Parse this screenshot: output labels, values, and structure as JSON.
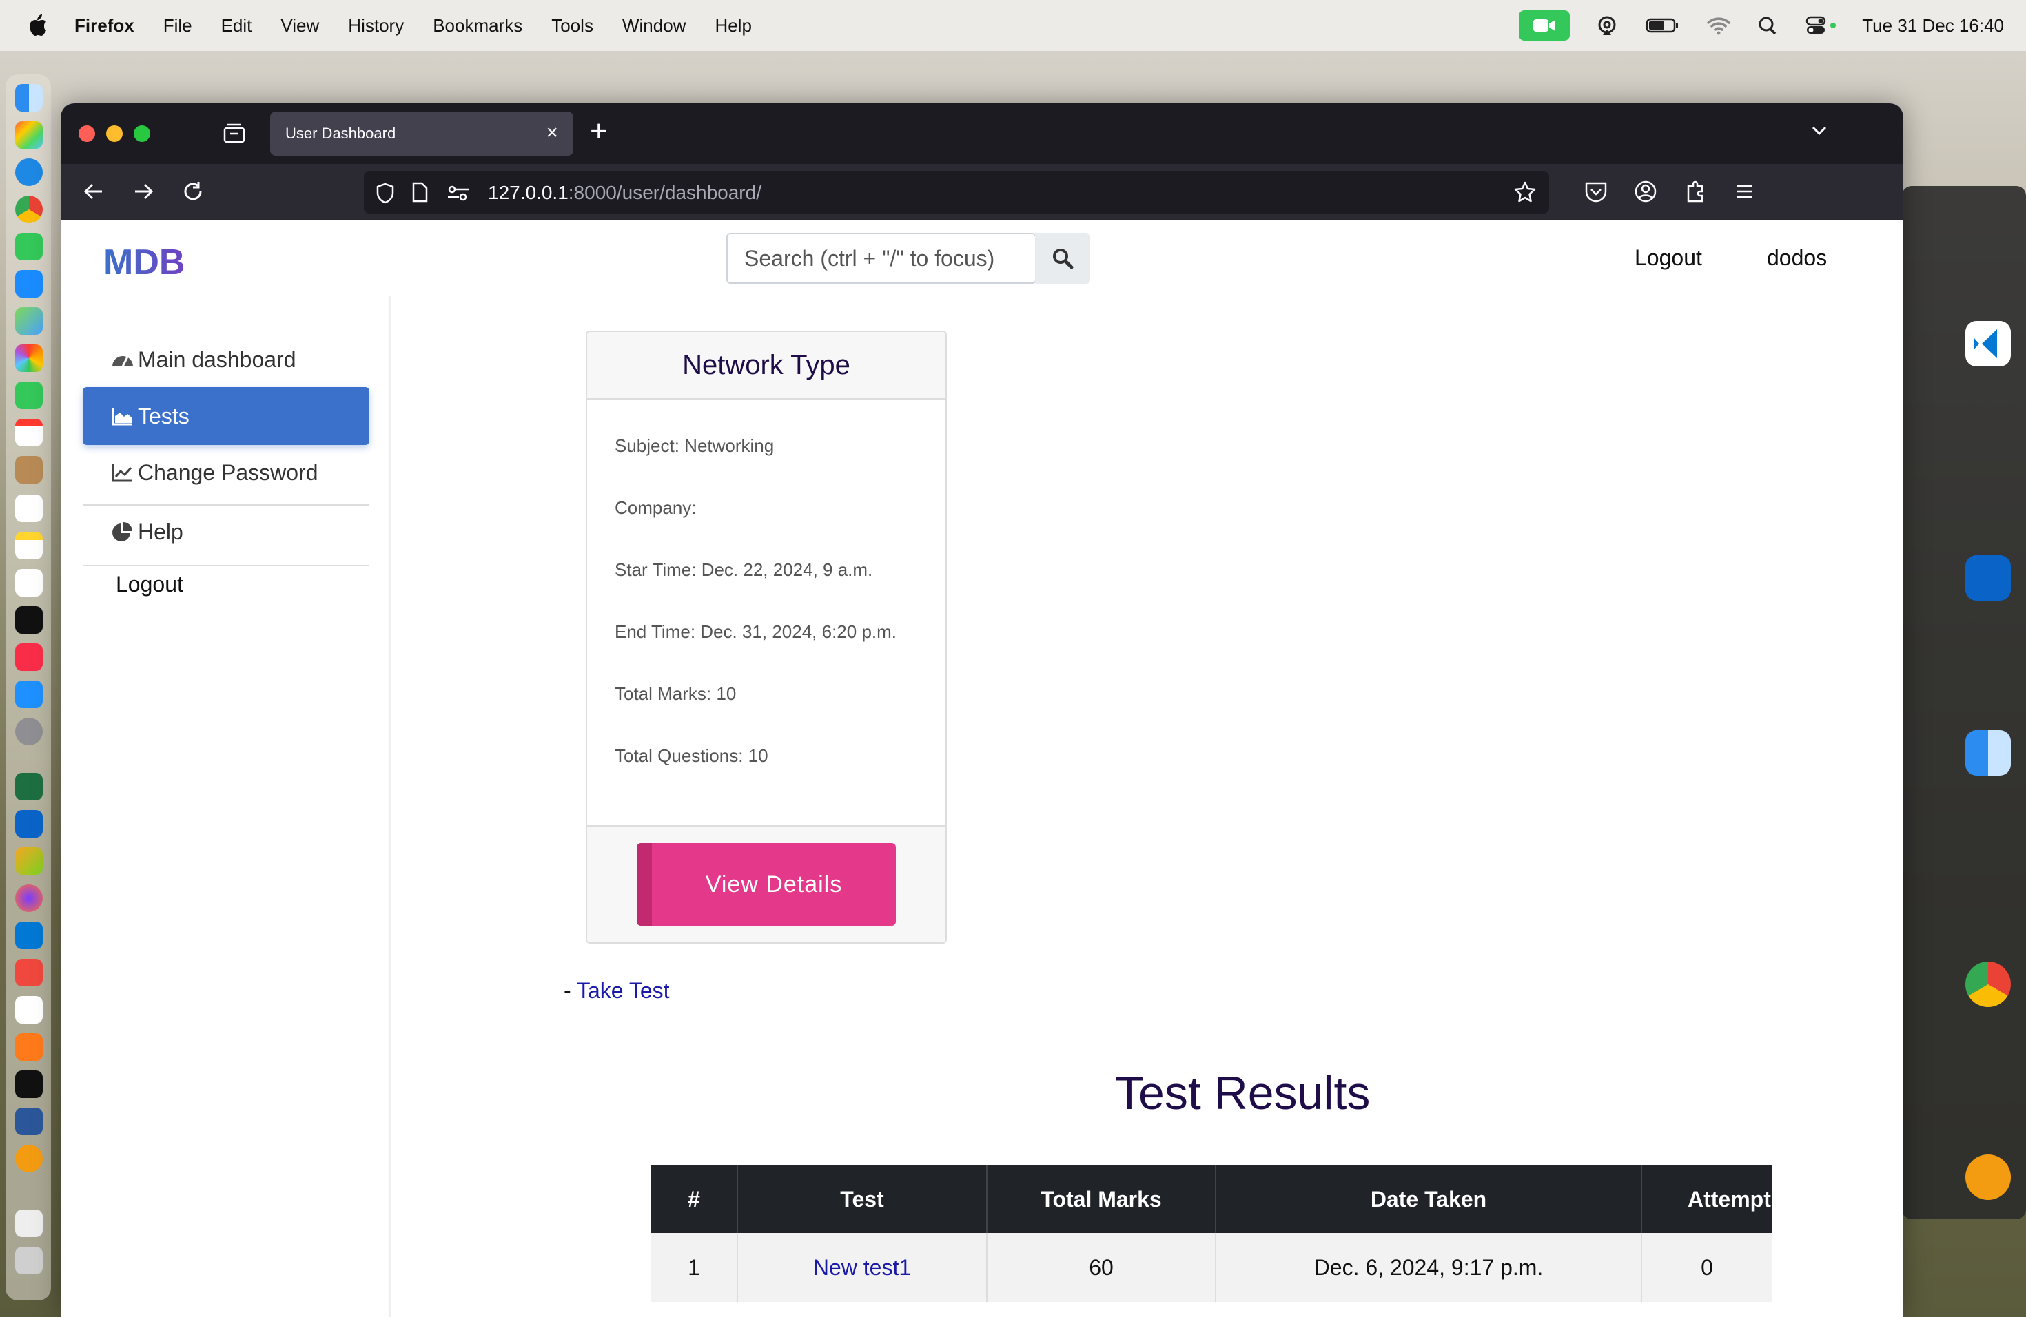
{
  "menubar": {
    "app": "Firefox",
    "items": [
      "File",
      "Edit",
      "View",
      "History",
      "Bookmarks",
      "Tools",
      "Window",
      "Help"
    ],
    "clock": "Tue 31 Dec  16:40"
  },
  "browser": {
    "tab_title": "User Dashboard",
    "url_host": "127.0.0.1",
    "url_path": ":8000/user/dashboard/"
  },
  "header": {
    "logo": "MDB",
    "search_placeholder": "Search (ctrl + \"/\" to focus)",
    "logout": "Logout",
    "username": "dodos"
  },
  "sidebar": {
    "items": [
      {
        "label": "Main dashboard",
        "icon": "dashboard-gauge-icon"
      },
      {
        "label": "Tests",
        "icon": "area-chart-icon",
        "active": true
      },
      {
        "label": "Change Password",
        "icon": "line-chart-icon"
      },
      {
        "label": "Help",
        "icon": "pie-chart-icon"
      }
    ],
    "logout": "Logout"
  },
  "test_card": {
    "title": "Network Type",
    "subject": "Subject: Networking",
    "company": "Company:",
    "start": "Star Time: Dec. 22, 2024, 9 a.m.",
    "end": "End Time: Dec. 31, 2024, 6:20 p.m.",
    "marks": "Total Marks: 10",
    "questions": "Total Questions: 10",
    "button": "View Details"
  },
  "take_test": {
    "prefix": "- ",
    "link": "Take Test"
  },
  "results": {
    "title": "Test Results",
    "columns": [
      "#",
      "Test",
      "Total Marks",
      "Date Taken",
      "Attempt"
    ],
    "rows": [
      {
        "num": "1",
        "test": "New test1",
        "marks": "60",
        "date": "Dec. 6, 2024, 9:17 p.m.",
        "attempt": "0"
      }
    ]
  },
  "colors": {
    "accent": "#3b71ca",
    "button": "#e4398a",
    "title": "#1f0d4a"
  }
}
